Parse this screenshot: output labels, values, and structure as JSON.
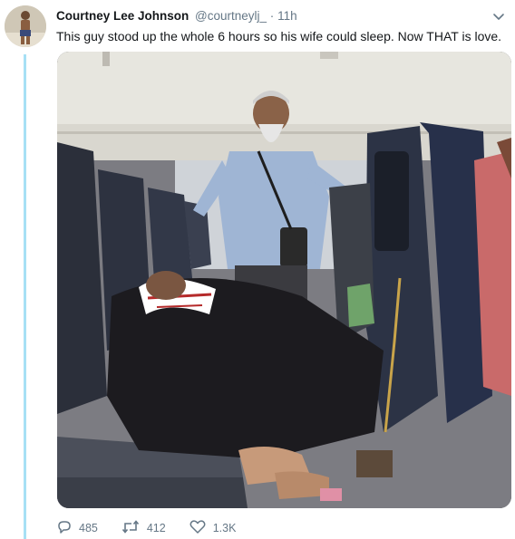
{
  "tweet": {
    "display_name": "Courtney Lee Johnson",
    "handle": "@courtneylj_",
    "separator": "·",
    "time": "11h",
    "text": "This guy stood up the whole 6 hours so his wife could sleep. Now THAT is love."
  },
  "actions": {
    "replies": "485",
    "retweets": "412",
    "likes": "1.3K"
  },
  "icons": {
    "menu": "chevron-down-icon",
    "reply": "reply-icon",
    "retweet": "retweet-icon",
    "like": "heart-icon"
  },
  "colors": {
    "thread_line": "#a7e0f5",
    "muted_text": "#657786",
    "primary_text": "#14171a"
  }
}
